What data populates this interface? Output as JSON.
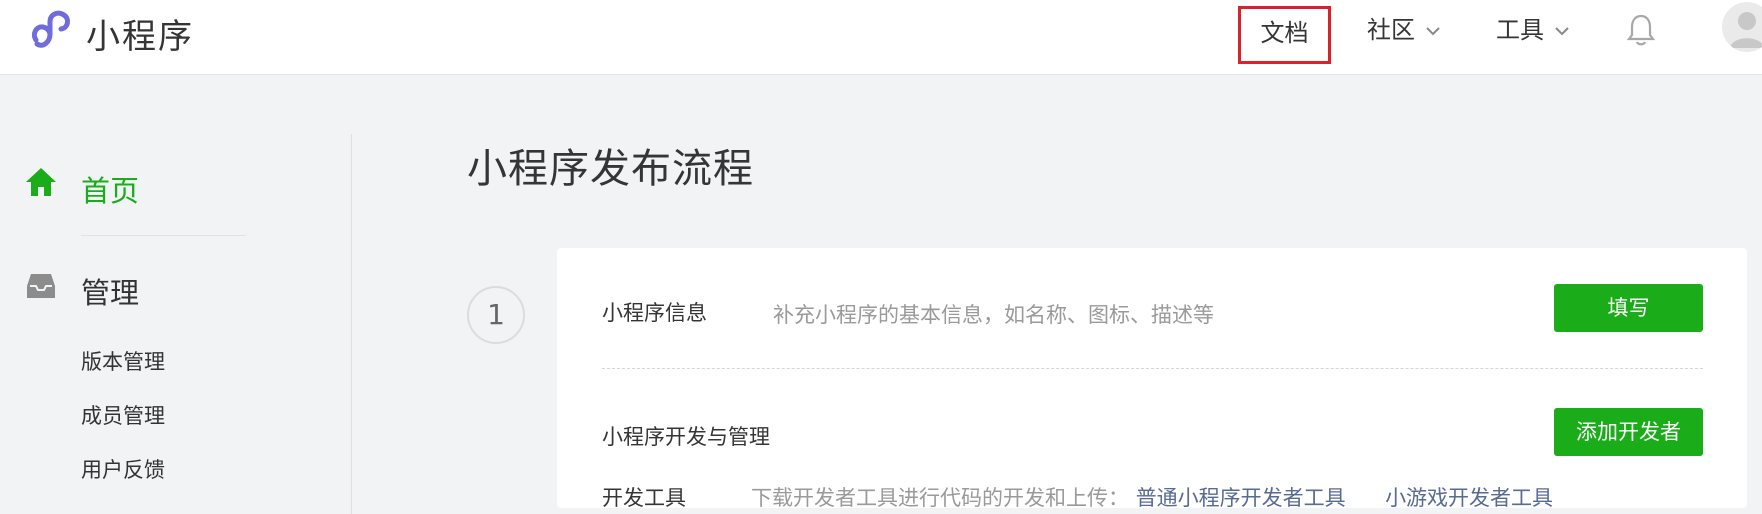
{
  "header": {
    "brand": "小程序",
    "nav": {
      "docs": "文档",
      "community": "社区",
      "tools": "工具"
    }
  },
  "sidebar": {
    "home": "首页",
    "manage": "管理",
    "sub_items": [
      "版本管理",
      "成员管理",
      "用户反馈"
    ]
  },
  "main": {
    "title": "小程序发布流程",
    "step_number": "1",
    "rows": {
      "info_title": "小程序信息",
      "info_desc": "补充小程序的基本信息，如名称、图标、描述等",
      "info_button": "填写",
      "dev_title": "小程序开发与管理",
      "dev_button": "添加开发者",
      "tools_title": "开发工具",
      "tools_desc": "下载开发者工具进行代码的开发和上传：",
      "tools_link1": "普通小程序开发者工具",
      "tools_link2": "小游戏开发者工具"
    }
  },
  "colors": {
    "accent_green": "#1aad19",
    "highlight_red": "#d9232c",
    "logo_purple": "#6f6cdc",
    "link_blue": "#576b95"
  }
}
